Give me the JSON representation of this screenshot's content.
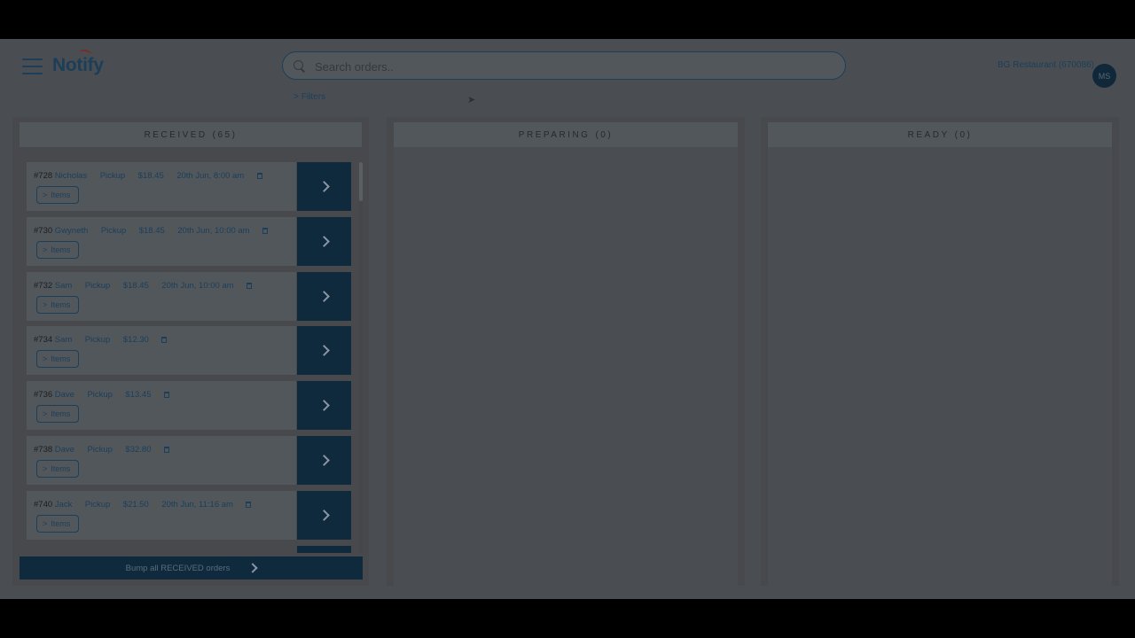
{
  "header": {
    "logo_text": "Notify",
    "search_placeholder": "Search orders..",
    "filters_label": "Filters",
    "restaurant": "BG Restaurant (670086)",
    "avatar_initials": "MS"
  },
  "columns": {
    "received": {
      "title": "RECEIVED",
      "count": "(65)"
    },
    "preparing": {
      "title": "PREPARING",
      "count": "(0)"
    },
    "ready": {
      "title": "READY",
      "count": "(0)"
    }
  },
  "orders": [
    {
      "number": "#728",
      "name": "Nicholas",
      "type": "Pickup",
      "price": "$18.45",
      "time": "20th Jun, 8:00 am"
    },
    {
      "number": "#730",
      "name": "Gwyneth",
      "type": "Pickup",
      "price": "$18.45",
      "time": "20th Jun, 10:00 am"
    },
    {
      "number": "#732",
      "name": "Sam",
      "type": "Pickup",
      "price": "$18.45",
      "time": "20th Jun, 10:00 am"
    },
    {
      "number": "#734",
      "name": "Sam",
      "type": "Pickup",
      "price": "$12.30",
      "time": ""
    },
    {
      "number": "#736",
      "name": "Dave",
      "type": "Pickup",
      "price": "$13.45",
      "time": ""
    },
    {
      "number": "#738",
      "name": "Dave",
      "type": "Pickup",
      "price": "$32.80",
      "time": ""
    },
    {
      "number": "#740",
      "name": "Jack",
      "type": "Pickup",
      "price": "$21.50",
      "time": "20th Jun, 11:16 am"
    }
  ],
  "items_label": "Items",
  "bump_all_label": "Bump all RECEIVED orders"
}
